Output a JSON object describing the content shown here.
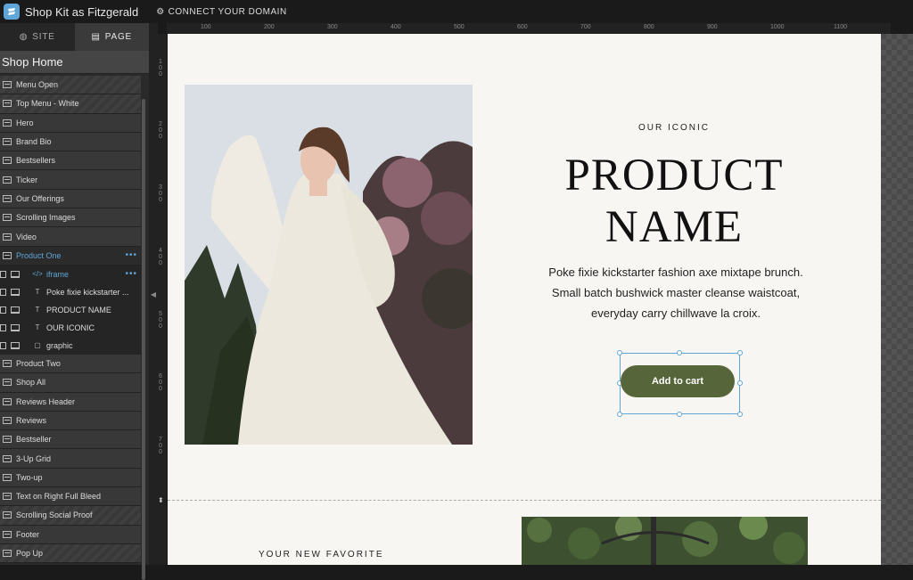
{
  "app": {
    "title": "Shop Kit as Fitzgerald",
    "connect_label": "CONNECT YOUR DOMAIN"
  },
  "sidebar": {
    "tabs": [
      {
        "label": "SITE"
      },
      {
        "label": "PAGE"
      }
    ],
    "page_title": "Shop Home",
    "items": [
      {
        "label": "Menu Open"
      },
      {
        "label": "Top Menu - White"
      },
      {
        "label": "Hero"
      },
      {
        "label": "Brand Bio"
      },
      {
        "label": "Bestsellers"
      },
      {
        "label": "Ticker"
      },
      {
        "label": "Our Offerings"
      },
      {
        "label": "Scrolling Images"
      },
      {
        "label": "Video"
      },
      {
        "label": "Product One"
      }
    ],
    "children": [
      {
        "label": "iframe",
        "tag": "</>"
      },
      {
        "label": "Poke fixie kickstarter ...",
        "tag": "T"
      },
      {
        "label": "PRODUCT NAME",
        "tag": "T"
      },
      {
        "label": "OUR ICONIC",
        "tag": "T"
      },
      {
        "label": "graphic",
        "tag": ""
      }
    ],
    "items_after": [
      {
        "label": "Product Two"
      },
      {
        "label": "Shop All"
      },
      {
        "label": "Reviews Header"
      },
      {
        "label": "Reviews"
      },
      {
        "label": "Bestseller"
      },
      {
        "label": "3-Up Grid"
      },
      {
        "label": "Two-up"
      },
      {
        "label": "Text on Right Full Bleed"
      },
      {
        "label": "Scrolling Social Proof"
      },
      {
        "label": "Footer"
      },
      {
        "label": "Pop Up"
      }
    ]
  },
  "ruler": {
    "top": [
      "100",
      "200",
      "300",
      "400",
      "500",
      "600",
      "700",
      "800",
      "900",
      "1000",
      "1100"
    ],
    "left": [
      "100",
      "200",
      "300",
      "400",
      "500",
      "600",
      "700"
    ]
  },
  "canvas": {
    "eyebrow": "OUR ICONIC",
    "product_name_line1": "PRODUCT",
    "product_name_line2": "NAME",
    "description": "Poke fixie kickstarter fashion axe mixtape brunch. Small batch bushwick master cleanse waistcoat, everyday carry chillwave la croix.",
    "cart_label": "Add to cart",
    "next_heading": "YOUR NEW FAVORITE"
  }
}
